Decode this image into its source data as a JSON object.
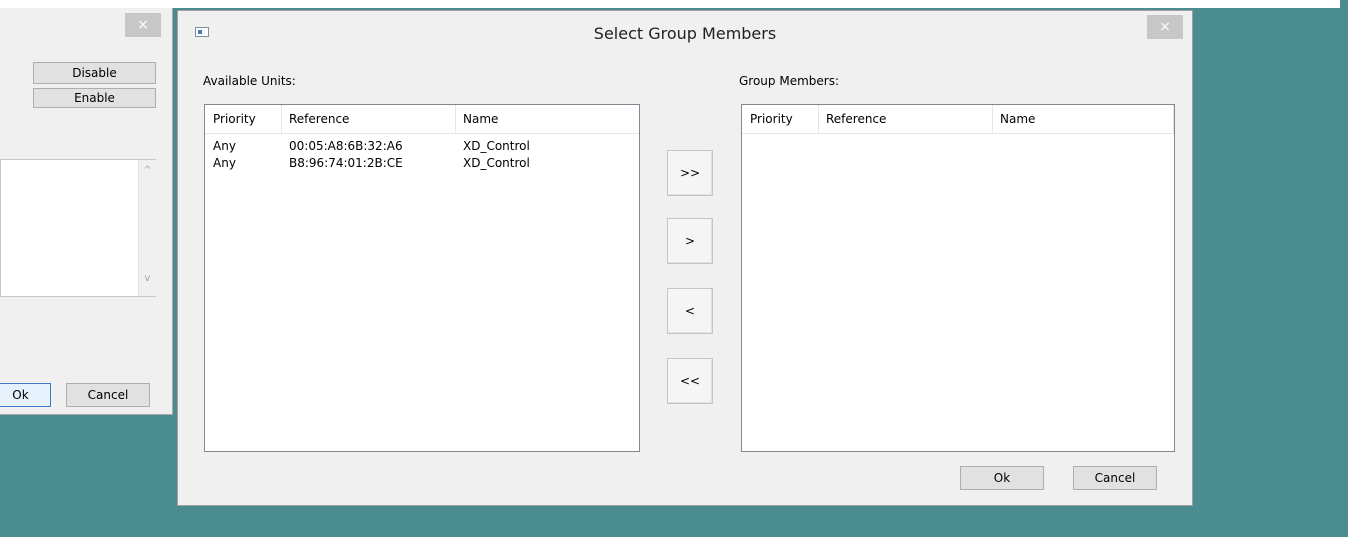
{
  "background_dialog": {
    "close_glyph": "×",
    "disable_label": "Disable",
    "enable_label": "Enable",
    "scroll_up_glyph": "^",
    "scroll_down_glyph": "v",
    "ok_label": "Ok",
    "cancel_label": "Cancel"
  },
  "dialog": {
    "title": "Select Group Members",
    "close_glyph": "×",
    "available_label": "Available Units:",
    "members_label": "Group Members:",
    "columns": [
      "Priority",
      "Reference",
      "Name"
    ],
    "available_rows": [
      {
        "priority": "Any",
        "reference": "00:05:A8:6B:32:A6",
        "name": "XD_Control"
      },
      {
        "priority": "Any",
        "reference": "B8:96:74:01:2B:CE",
        "name": "XD_Control"
      }
    ],
    "member_rows": [],
    "move_buttons": {
      "add_all": ">>",
      "add_one": ">",
      "remove_one": "<",
      "remove_all": "<<"
    },
    "ok_label": "Ok",
    "cancel_label": "Cancel"
  },
  "colors": {
    "desktop": "#4b8c91",
    "dialog_bg": "#f0f0f0",
    "close_button": "#c7c7c7"
  }
}
